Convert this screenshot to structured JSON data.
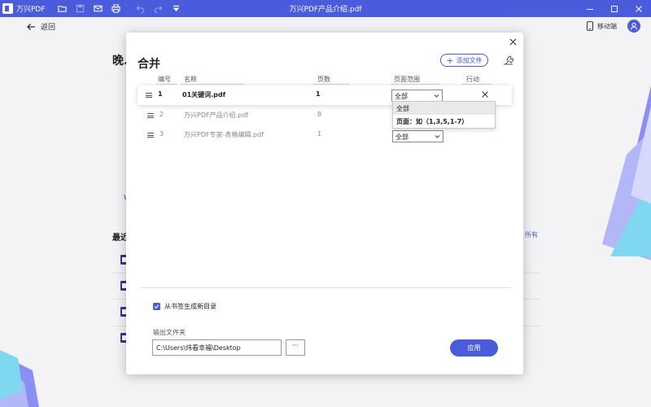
{
  "titlebar": {
    "app_name": "万兴PDF",
    "doc_title": "万兴PDF产品介绍.pdf",
    "icons": [
      "folder-icon",
      "save-icon",
      "mail-icon",
      "print-icon",
      "undo-icon",
      "redo-icon",
      "dropdown-icon"
    ]
  },
  "header": {
    "back_label": "返回",
    "mobile_label": "移动端"
  },
  "background": {
    "greeting": "晚...",
    "fragment": "W",
    "recent_title": "最近",
    "view_all": "所有"
  },
  "modal": {
    "title": "合并",
    "add_file_label": "添加文件",
    "columns": {
      "index": "编号",
      "name": "名称",
      "pages": "页数",
      "range": "页面范围",
      "action": "行动"
    },
    "files": [
      {
        "index": "1",
        "name": "01关键词.pdf",
        "pages": "1",
        "range": "全部"
      },
      {
        "index": "2",
        "name": "万兴PDF产品介绍.pdf",
        "pages": "8",
        "range": "全部"
      },
      {
        "index": "3",
        "name": "万兴PDF专家-表格编辑.pdf",
        "pages": "1",
        "range": "全部"
      }
    ],
    "range_options": [
      "全部",
      "页面：如（1,3,5,1-7）"
    ],
    "bookmark_toc_label": "从书签生成新目录",
    "bookmark_toc_checked": true,
    "output_folder_label": "输出文件夹",
    "output_folder_value": "C:\\Users\\炜看幸福\\Desktop",
    "browse_label": "···",
    "apply_label": "应用"
  },
  "colors": {
    "accent": "#4a5bdc",
    "titlebar": "#4a5bdc"
  }
}
